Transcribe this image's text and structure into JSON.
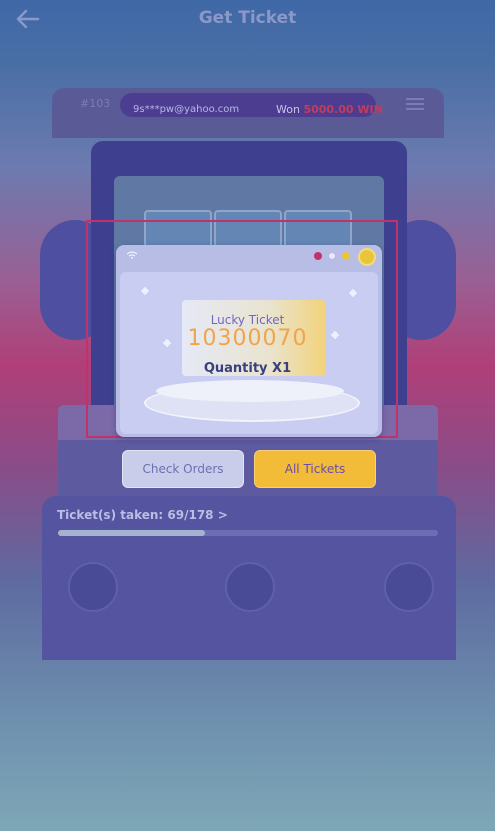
{
  "header": {
    "title": "Get Ticket"
  },
  "machine": {
    "round_number": "#103",
    "winner_email": "9s***pw@yahoo.com",
    "winner_won_prefix": "Won",
    "winner_amount": "5000.00 WIN"
  },
  "progress": {
    "label": "Ticket(s) taken: 69/178 >",
    "taken": 69,
    "total": 178
  },
  "popup": {
    "lucky_label": "Lucky Ticket",
    "ticket_number": "10300070",
    "quantity_label": "Quantity X1",
    "check_orders_label": "Check Orders",
    "all_tickets_label": "All Tickets"
  },
  "colors": {
    "accent": "#f2bb38",
    "highlight": "#c0336a",
    "number": "#f0a44b"
  },
  "icons": {
    "back": "arrow-left-icon",
    "menu": "menu-icon",
    "coin": "coin-icon"
  }
}
